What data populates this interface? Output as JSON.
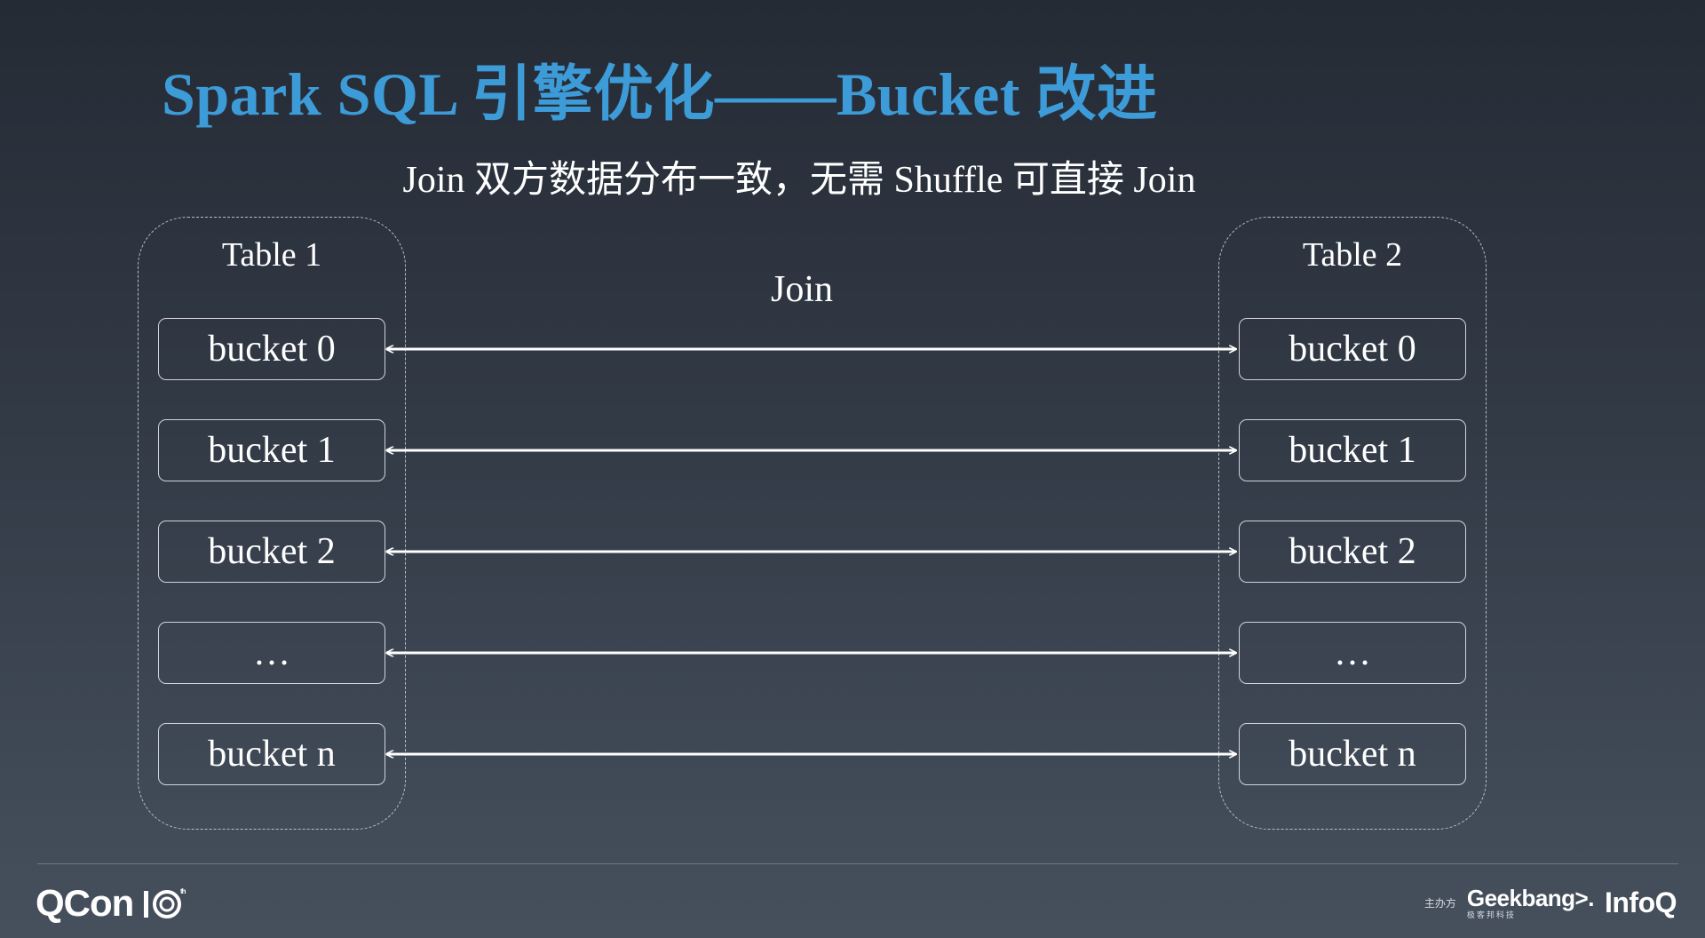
{
  "slide": {
    "title": "Spark SQL 引擎优化——Bucket 改进",
    "subtitle": "Join 双方数据分布一致，无需 Shuffle 可直接 Join"
  },
  "diagram": {
    "join_label": "Join",
    "left_table": {
      "label": "Table 1",
      "buckets": [
        "bucket 0",
        "bucket 1",
        "bucket 2",
        "…",
        "bucket n"
      ]
    },
    "right_table": {
      "label": "Table 2",
      "buckets": [
        "bucket 0",
        "bucket 1",
        "bucket 2",
        "…",
        "bucket n"
      ]
    },
    "connections": [
      {
        "from": "bucket 0",
        "to": "bucket 0",
        "direction": "bidirectional"
      },
      {
        "from": "bucket 1",
        "to": "bucket 1",
        "direction": "bidirectional"
      },
      {
        "from": "bucket 2",
        "to": "bucket 2",
        "direction": "bidirectional"
      },
      {
        "from": "…",
        "to": "…",
        "direction": "bidirectional"
      },
      {
        "from": "bucket n",
        "to": "bucket n",
        "direction": "bidirectional"
      }
    ]
  },
  "footer": {
    "conference_logo": "QCon",
    "sponsor_host_label": "主办方",
    "sponsor_geekbang": "Geekbang>.",
    "sponsor_geekbang_sub": "极客邦科技",
    "sponsor_infoq": "InfoQ"
  },
  "colors": {
    "title": "#3d9bd8",
    "background_top": "#252b35",
    "background_bottom": "#46505d",
    "text": "#ffffff"
  }
}
